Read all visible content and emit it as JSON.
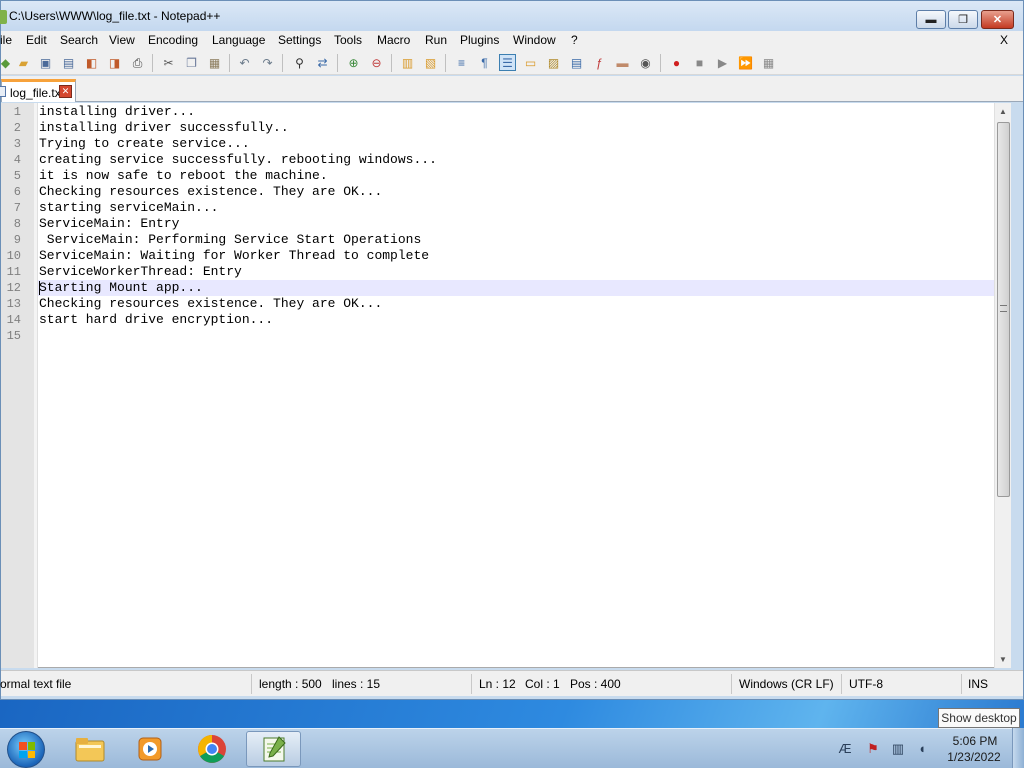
{
  "window": {
    "title": "C:\\Users\\WWW\\log_file.txt - Notepad++",
    "min_glyph": "▬",
    "max_glyph": "❐",
    "close_glyph": "✕"
  },
  "menu": {
    "items": [
      "ile",
      "Edit",
      "Search",
      "View",
      "Encoding",
      "Language",
      "Settings",
      "Tools",
      "Macro",
      "Run",
      "Plugins",
      "Window",
      "?"
    ],
    "close_x": "X"
  },
  "tab": {
    "label": "log_file.txt",
    "close_glyph": "✕"
  },
  "editor": {
    "line_numbers": [
      "1",
      "2",
      "3",
      "4",
      "5",
      "6",
      "7",
      "8",
      "9",
      "10",
      "11",
      "12",
      "13",
      "14",
      "15"
    ],
    "lines": [
      "installing driver...",
      "installing driver successfully..",
      "Trying to create service...",
      "creating service successfully. rebooting windows...",
      "it is now safe to reboot the machine.",
      "Checking resources existence. They are OK...",
      "starting serviceMain...",
      "ServiceMain: Entry",
      " ServiceMain: Performing Service Start Operations",
      "ServiceMain: Waiting for Worker Thread to complete",
      "ServiceWorkerThread: Entry",
      "Starting Mount app...",
      "Checking resources existence. They are OK...",
      "start hard drive encryption...",
      ""
    ],
    "current_line": 12
  },
  "statusbar": {
    "file_type": "ormal text file",
    "length": "length : 500",
    "lines": "lines : 15",
    "ln": "Ln : 12",
    "col": "Col : 1",
    "pos": "Pos : 400",
    "eol": "Windows (CR LF)",
    "encoding": "UTF-8",
    "mode": "INS"
  },
  "taskbar": {
    "tooltip": "Show desktop",
    "clock_time": "5:06 PM",
    "clock_date": "1/23/2022"
  },
  "icons": {
    "toolbar": [
      "new-file-icon",
      "open-file-icon",
      "save-icon",
      "save-all-icon",
      "close-icon",
      "close-all-icon",
      "print-icon",
      "cut-icon",
      "copy-icon",
      "paste-icon",
      "undo-icon",
      "redo-icon",
      "find-icon",
      "replace-icon",
      "zoom-in-icon",
      "zoom-out-icon",
      "sync-vertical-icon",
      "sync-horizontal-icon",
      "word-wrap-icon",
      "show-all-chars-icon",
      "indent-guide-icon",
      "udl-icon",
      "doc-map-icon",
      "function-list-icon",
      "folder-workspace-icon",
      "folder-icon",
      "monitoring-icon",
      "record-macro-icon",
      "stop-record-icon",
      "play-macro-icon",
      "run-macro-multiple-icon",
      "save-macro-icon"
    ]
  },
  "colors": {
    "current_line_highlight": "#e8e8ff",
    "tab_accent": "#f7a23b",
    "title_bar": "#c4d8ef"
  }
}
